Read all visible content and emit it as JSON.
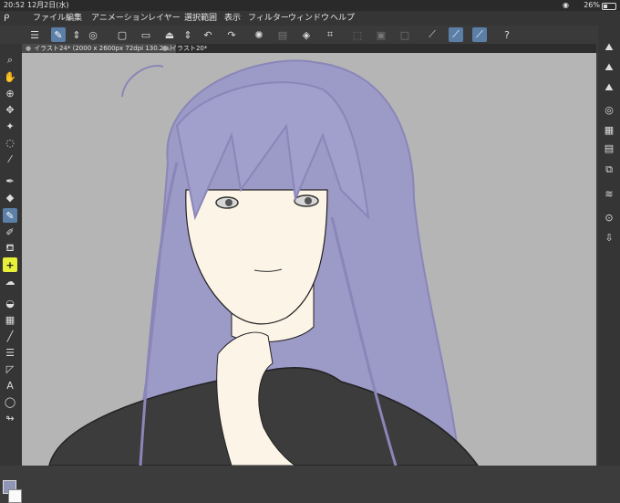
{
  "status": {
    "time": "20:52",
    "date": "12月2日(水)",
    "battery": "26%"
  },
  "menu": [
    "ファイル",
    "編集",
    "アニメーション",
    "レイヤー",
    "選択範囲",
    "表示",
    "フィルター",
    "ウィンドウ",
    "ヘルプ"
  ],
  "toolbar_icons": [
    "menu-icon",
    "select-tool-icon",
    "chevron-updown-icon",
    "sub-view-icon",
    "new-file-icon",
    "open-file-icon",
    "save-icon",
    "chevron-updown-icon",
    "undo-icon",
    "redo-icon",
    "loading-icon",
    "clear-icon",
    "fill-icon",
    "crop-icon",
    "transform-icon",
    "hide-selection-icon",
    "deselect-icon",
    "ruler-icon",
    "snap-ruler-icon",
    "snap-special-ruler-icon",
    "help-icon"
  ],
  "tabs": [
    {
      "label": "イラスト24* (2000 x 2600px 72dpi 130.2%)"
    },
    {
      "label": "イラスト20*"
    }
  ],
  "left_tools": [
    "search-icon",
    "hand-icon",
    "zoom-icon",
    "move-icon",
    "wand-icon",
    "lasso-icon",
    "eyedropper-icon",
    "pen-icon",
    "eraser-icon",
    "pencil-icon",
    "brush-icon",
    "spray-icon",
    "plus-icon",
    "blend-icon",
    "fill-bucket-icon",
    "gradient-icon",
    "line-icon",
    "frame-icon",
    "shape-icon",
    "text-icon",
    "balloon-icon",
    "correct-line-icon"
  ],
  "right_tools": [
    "brush-size-icon",
    "tool-property-icon",
    "sub-tool-icon",
    "navigator-icon",
    "color-wheel-icon",
    "color-slider-icon",
    "layer-property-icon",
    "layers-icon",
    "search-layer-icon",
    "export-icon"
  ],
  "colors": {
    "main": "#8e95b6",
    "sub": "#fafafa",
    "accent": "#5c7fa8",
    "canvas": "#b5b5b5"
  }
}
